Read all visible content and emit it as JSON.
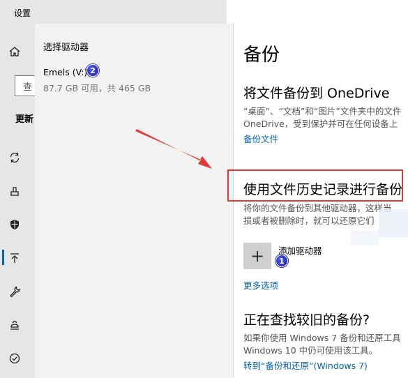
{
  "app": {
    "title": "设置"
  },
  "sidebar": {
    "search_fragment": "查",
    "update_fragment": "更新",
    "icons": [
      "home-icon",
      "sync-icon",
      "delivery-icon",
      "shield-icon",
      "backup-icon",
      "wrench-icon",
      "recovery-icon",
      "activation-icon"
    ]
  },
  "flyout": {
    "title": "选择驱动器",
    "drives": [
      {
        "name": "Emels (V:)",
        "info": "87.7 GB 可用，共 465 GB"
      }
    ]
  },
  "main": {
    "page_title": "备份",
    "onedrive": {
      "heading": "将文件备份到 OneDrive",
      "desc_line1": "“桌面”、“文档”和“图片”文件夹中的文件",
      "desc_line2": "OneDrive，受到保护并可在任何设备上",
      "link": "备份文件"
    },
    "history": {
      "heading": "使用文件历史记录进行备份",
      "desc_line1": "将你的文件备份到其他驱动器，这样当",
      "desc_line2": "损或者被删除时，就可以还原它们",
      "add_drive_label": "添加驱动器",
      "more_options": "更多选项"
    },
    "older": {
      "heading": "正在查找较旧的备份?",
      "desc_line1": "如果你使用 Windows 7 备份和还原工具",
      "desc_line2": "Windows 10 中仍可使用该工具。",
      "link": "转到“备份和还原”(Windows 7)"
    }
  },
  "markers": {
    "one": "1",
    "two": "2"
  },
  "colors": {
    "accent": "#0063b1",
    "highlight": "#e53935",
    "marker": "#1a1aa8"
  }
}
